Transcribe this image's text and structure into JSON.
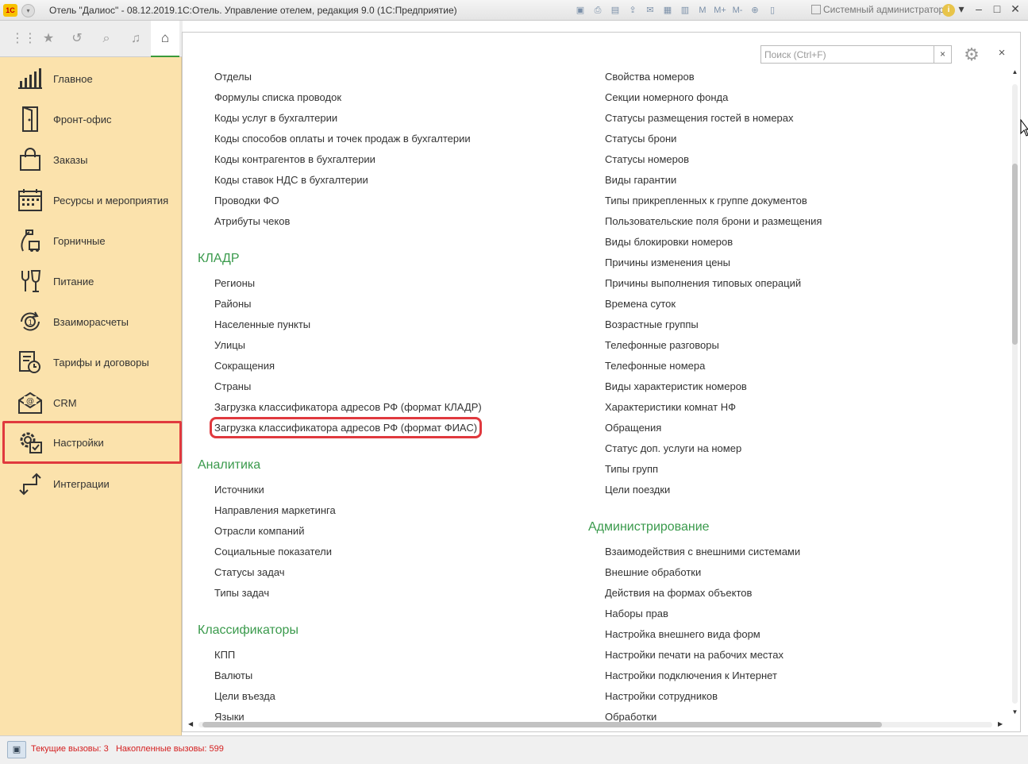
{
  "titlebar": {
    "logo": "1С",
    "title": "Отель \"Далиос\" - 08.12.2019.1С:Отель. Управление отелем, редакция 9.0  (1С:Предприятие)",
    "memory_labels": [
      "M",
      "M+",
      "M-"
    ],
    "user": "Системный администратор",
    "info": "i"
  },
  "navstrip": {
    "icons": [
      "apps-grid-icon",
      "star-icon",
      "history-icon",
      "search-icon",
      "bell-icon",
      "home-icon"
    ]
  },
  "sidebar": {
    "items": [
      {
        "label": "Главное",
        "icon": "chart-bars-icon"
      },
      {
        "label": "Фронт-офис",
        "icon": "door-icon"
      },
      {
        "label": "Заказы",
        "icon": "shopping-bag-icon"
      },
      {
        "label": "Ресурсы и мероприятия",
        "icon": "calendar-icon"
      },
      {
        "label": "Горничные",
        "icon": "vacuum-cleaner-icon"
      },
      {
        "label": "Питание",
        "icon": "fork-glass-icon"
      },
      {
        "label": "Взаиморасчеты",
        "icon": "cycle-money-icon"
      },
      {
        "label": "Тарифы и договоры",
        "icon": "contract-icon"
      },
      {
        "label": "CRM",
        "icon": "mail-at-icon"
      },
      {
        "label": "Настройки",
        "icon": "settings-gears-icon",
        "active": true
      },
      {
        "label": "Интеграции",
        "icon": "integration-arrows-icon"
      }
    ]
  },
  "search": {
    "placeholder": "Поиск (Ctrl+F)",
    "clear": "×"
  },
  "close_label": "×",
  "left_column": {
    "top_links": [
      "Отделы",
      "Формулы списка проводок",
      "Коды услуг в бухгалтерии",
      "Коды способов оплаты и точек продаж в бухгалтерии",
      "Коды контрагентов в бухгалтерии",
      "Коды ставок НДС в бухгалтерии",
      "Проводки ФО",
      "Атрибуты чеков"
    ],
    "sections": [
      {
        "title": "КЛАДР",
        "links": [
          "Регионы",
          "Районы",
          "Населенные пункты",
          "Улицы",
          "Сокращения",
          "Страны",
          "Загрузка классификатора адресов РФ (формат КЛАДР)",
          "Загрузка классификатора адресов РФ (формат ФИАС)"
        ]
      },
      {
        "title": "Аналитика",
        "links": [
          "Источники",
          "Направления маркетинга",
          "Отрасли компаний",
          "Социальные показатели",
          "Статусы задач",
          "Типы задач"
        ]
      },
      {
        "title": "Классификаторы",
        "links": [
          "КПП",
          "Валюты",
          "Цели въезда",
          "Языки"
        ]
      }
    ]
  },
  "right_column": {
    "top_links": [
      "Свойства номеров",
      "Секции номерного фонда",
      "Статусы размещения гостей в номерах",
      "Статусы брони",
      "Статусы номеров",
      "Виды гарантии",
      "Типы прикрепленных к группе документов",
      "Пользовательские поля брони и размещения",
      "Виды блокировки номеров",
      "Причины изменения цены",
      "Причины выполнения типовых операций",
      "Времена суток",
      "Возрастные группы",
      "Телефонные разговоры",
      "Телефонные номера",
      "Виды характеристик номеров",
      "Характеристики комнат НФ",
      "Обращения",
      "Статус доп. услуги на номер",
      "Типы групп",
      "Цели поездки"
    ],
    "sections": [
      {
        "title": "Администрирование",
        "links": [
          "Взаимодействия с внешними системами",
          "Внешние обработки",
          "Действия на формах объектов",
          "Наборы прав",
          "Настройка внешнего вида форм",
          "Настройки печати на рабочих местах",
          "Настройки подключения к Интернет",
          "Настройки сотрудников",
          "Обработки"
        ]
      }
    ]
  },
  "statusbar": {
    "current_calls": "Текущие вызовы: 3",
    "accumulated_calls": "Накопленные вызовы: 599"
  },
  "colors": {
    "sidebar_bg": "#fbe2ac",
    "section_heading": "#3a9a4c",
    "highlight_border": "#e0393e",
    "status_text": "#d42020"
  }
}
